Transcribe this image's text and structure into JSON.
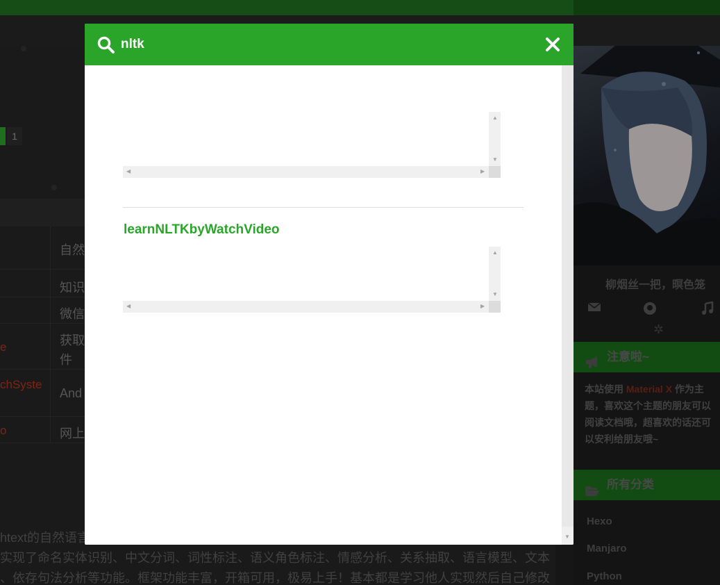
{
  "search": {
    "query": "nltk"
  },
  "results": [
    {
      "title": ""
    },
    {
      "title": "learnNLTKbyWatchVideo"
    }
  ],
  "background": {
    "pager": {
      "current": "1"
    },
    "table_rows": [
      {
        "name": "",
        "desc": "自然"
      },
      {
        "name": "",
        "desc": "知识"
      },
      {
        "name": "",
        "desc": "微信"
      },
      {
        "name": "e",
        "desc": "获取",
        "desc2": "件"
      },
      {
        "name": "chSyste",
        "desc": "And"
      },
      {
        "name": "o",
        "desc": "网上"
      }
    ],
    "paragraph_lines": [
      "htext的自然语言",
      "实现了命名实体识别、中文分词、词性标注、语义角色标注、情感分析、关系抽取、语言模型、文本",
      "、依存句法分析等功能。框架功能丰富，开箱可用，极易上手！基本都是学习他人实现然后自己修改"
    ],
    "sidebar": {
      "motto": "柳烟丝一把，暝色笼",
      "notice_title": "注意啦~",
      "notice_text_before": "本站使用 ",
      "notice_highlight": "Material X",
      "notice_text_after": " 作为主题，喜欢这个主题的朋友可以阅读文档哦，超喜欢的话还可以安利给朋友哦~",
      "categories_title": "所有分类",
      "categories": [
        "Hexo",
        "Manjaro",
        "Python"
      ]
    }
  },
  "colors": {
    "accent": "#2aa52a",
    "header_bg": "#2aa52a",
    "result_title": "#2aa52a"
  }
}
